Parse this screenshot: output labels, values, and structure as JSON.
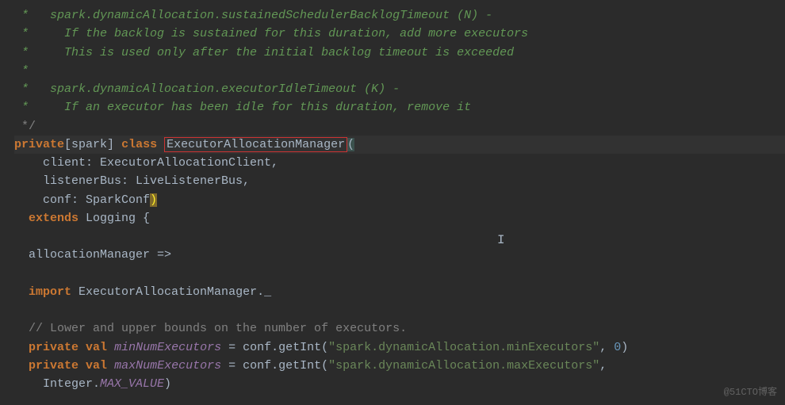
{
  "comments": {
    "c1": " *   spark.dynamicAllocation.sustainedSchedulerBacklogTimeout (N) -",
    "c2": " *     If the backlog is sustained for this duration, add more executors",
    "c3": " *     This is used only after the initial backlog timeout is exceeded",
    "c4": " *",
    "c5": " *   spark.dynamicAllocation.executorIdleTimeout (K) -",
    "c6": " *     If an executor has been idle for this duration, remove it",
    "c7": " */"
  },
  "decl": {
    "private": "private",
    "spark_open": "[",
    "spark": "spark",
    "spark_close": "] ",
    "class": "class ",
    "classname": "ExecutorAllocationManager",
    "open_paren": "(",
    "param1": "    client: ExecutorAllocationClient,",
    "param2": "    listenerBus: LiveListenerBus,",
    "param3_pre": "    conf: SparkConf",
    "close_paren": ")",
    "extends_indent": "  ",
    "extends": "extends",
    "logging": " Logging {",
    "self": "  allocationManager =>",
    "import_indent": "  ",
    "import": "import",
    "import_target": " ExecutorAllocationManager._",
    "bounds_comment": "  // Lower and upper bounds on the number of executors.",
    "min_indent": "  ",
    "min_kw1": "private",
    "min_sp": " ",
    "min_kw2": "val",
    "min_name_sp": " ",
    "min_name": "minNumExecutors",
    "min_eq": " = conf.getInt(",
    "min_str": "\"spark.dynamicAllocation.minExecutors\"",
    "min_comma": ", ",
    "min_def": "0",
    "min_close": ")",
    "max_indent": "  ",
    "max_kw1": "private",
    "max_sp": " ",
    "max_kw2": "val",
    "max_name_sp": " ",
    "max_name": "maxNumExecutors",
    "max_eq": " = conf.getInt(",
    "max_str": "\"spark.dynamicAllocation.maxExecutors\"",
    "max_comma": ",",
    "int_indent": "    Integer.",
    "int_field": "MAX_VALUE",
    "int_close": ")"
  },
  "watermark": "@51CTO博客",
  "cursor_char": "I"
}
